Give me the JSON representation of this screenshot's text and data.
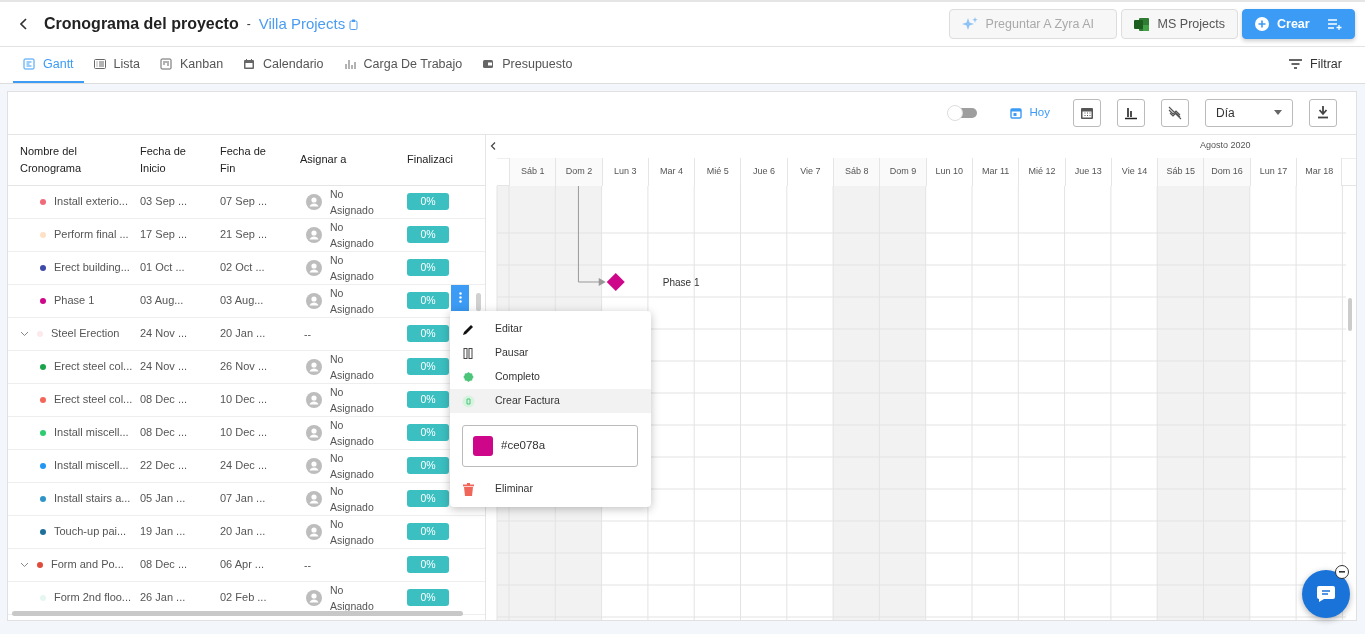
{
  "header": {
    "title": "Cronograma del proyecto",
    "separator": "-",
    "project": "Villa Projects"
  },
  "buttons": [
    {
      "label": "Preguntar A Zyra AI",
      "kind": "ai"
    },
    {
      "label": "MS Projects",
      "kind": "ms"
    },
    {
      "label": "Crear",
      "kind": "primary"
    }
  ],
  "tabs": [
    {
      "label": "Gantt",
      "kind": "gantt",
      "selected": true
    },
    {
      "label": "Lista",
      "kind": "list",
      "selected": false
    },
    {
      "label": "Kanban",
      "kind": "kanban",
      "selected": false
    },
    {
      "label": "Calendario",
      "kind": "calendar",
      "selected": false
    },
    {
      "label": "Carga De Trabajo",
      "kind": "workload",
      "selected": false
    },
    {
      "label": "Presupuesto",
      "kind": "budget",
      "selected": false
    }
  ],
  "filter": "Filtrar",
  "toolbar": {
    "toggle_on": false,
    "today": "Hoy",
    "scale": "Día"
  },
  "table": {
    "columns": [
      "Nombre del Cronograma",
      "Fecha de Inicio",
      "Fecha de Fin",
      "Asignar a",
      "Finalizaci"
    ],
    "groups": [
      {
        "children": [
          {
            "name": "Install exterio...",
            "color": "#f06a7a",
            "start": "03 Sep ...",
            "end": "07 Sep ...",
            "assignee": "No Asignado",
            "progress": "0%"
          },
          {
            "name": "Perform final ...",
            "color": "#fde0c5",
            "start": "17 Sep ...",
            "end": "21 Sep ...",
            "assignee": "No Asignado",
            "progress": "0%"
          },
          {
            "name": "Erect building...",
            "color": "#3f4aa8",
            "start": "01 Oct ...",
            "end": "02 Oct ...",
            "assignee": "No Asignado",
            "progress": "0%"
          },
          {
            "name": "Phase 1",
            "color": "#ce078a",
            "start": "03 Aug...",
            "end": "03 Aug...",
            "assignee": "No Asignado",
            "progress": "0%",
            "active": true,
            "bar": {
              "kind": "milestone",
              "label": "Phase 1"
            }
          }
        ]
      },
      {
        "name": "Steel Erection",
        "color": "#fde8ec",
        "start": "24 Nov ...",
        "end": "20 Jan ...",
        "assignee": "--",
        "progress": "0%",
        "expanded": true,
        "children": [
          {
            "name": "Erect steel col...",
            "color": "#1aa34a",
            "start": "24 Nov ...",
            "end": "26 Nov ...",
            "assignee": "No Asignado",
            "progress": "0%"
          },
          {
            "name": "Erect steel col...",
            "color": "#f4655a",
            "start": "08 Dec ...",
            "end": "10 Dec ...",
            "assignee": "No Asignado",
            "progress": "0%"
          },
          {
            "name": "Install miscell...",
            "color": "#2ecc71",
            "start": "08 Dec ...",
            "end": "10 Dec ...",
            "assignee": "No Asignado",
            "progress": "0%"
          },
          {
            "name": "Install miscell...",
            "color": "#2196f3",
            "start": "22 Dec ...",
            "end": "24 Dec ...",
            "assignee": "No Asignado",
            "progress": "0%"
          },
          {
            "name": "Install stairs a...",
            "color": "#2f95c8",
            "start": "05 Jan ...",
            "end": "07 Jan ...",
            "assignee": "No Asignado",
            "progress": "0%"
          },
          {
            "name": "Touch-up pai...",
            "color": "#1f6f9a",
            "start": "19 Jan ...",
            "end": "20 Jan ...",
            "assignee": "No Asignado",
            "progress": "0%"
          }
        ]
      },
      {
        "name": "Form and Po...",
        "color": "#e04a3a",
        "start": "08 Dec ...",
        "end": "06 Apr ...",
        "assignee": "--",
        "progress": "0%",
        "expanded": true,
        "children": [
          {
            "name": "Form 2nd floo...",
            "color": "#e6f7ef",
            "start": "26 Jan ...",
            "end": "02 Feb ...",
            "assignee": "No Asignado",
            "progress": "0%"
          }
        ]
      }
    ]
  },
  "gantt": {
    "month": "Agosto 2020",
    "days": [
      {
        "label": "Sáb 1",
        "weekend": true
      },
      {
        "label": "Dom 2",
        "weekend": true
      },
      {
        "label": "Lun 3",
        "weekend": false
      },
      {
        "label": "Mar 4",
        "weekend": false
      },
      {
        "label": "Mié 5",
        "weekend": false
      },
      {
        "label": "Jue 6",
        "weekend": false
      },
      {
        "label": "Vie 7",
        "weekend": false
      },
      {
        "label": "Sáb 8",
        "weekend": true
      },
      {
        "label": "Dom 9",
        "weekend": true
      },
      {
        "label": "Lun 10",
        "weekend": false
      },
      {
        "label": "Mar 11",
        "weekend": false
      },
      {
        "label": "Mié 12",
        "weekend": false
      },
      {
        "label": "Jue 13",
        "weekend": false
      },
      {
        "label": "Vie 14",
        "weekend": false
      },
      {
        "label": "Sáb 15",
        "weekend": true
      },
      {
        "label": "Dom 16",
        "weekend": true
      },
      {
        "label": "Lun 17",
        "weekend": false
      },
      {
        "label": "Mar 18",
        "weekend": false
      }
    ]
  },
  "context_menu": {
    "items": [
      {
        "label": "Editar",
        "kind": "edit",
        "highlighted": false
      },
      {
        "label": "Pausar",
        "kind": "pause",
        "highlighted": false
      },
      {
        "label": "Completo",
        "kind": "complete",
        "highlighted": false
      },
      {
        "label": "Crear Factura",
        "kind": "invoice",
        "highlighted": true
      }
    ],
    "color": "#ce078a",
    "color_label": "#ce078a",
    "delete": "Eliminar"
  }
}
